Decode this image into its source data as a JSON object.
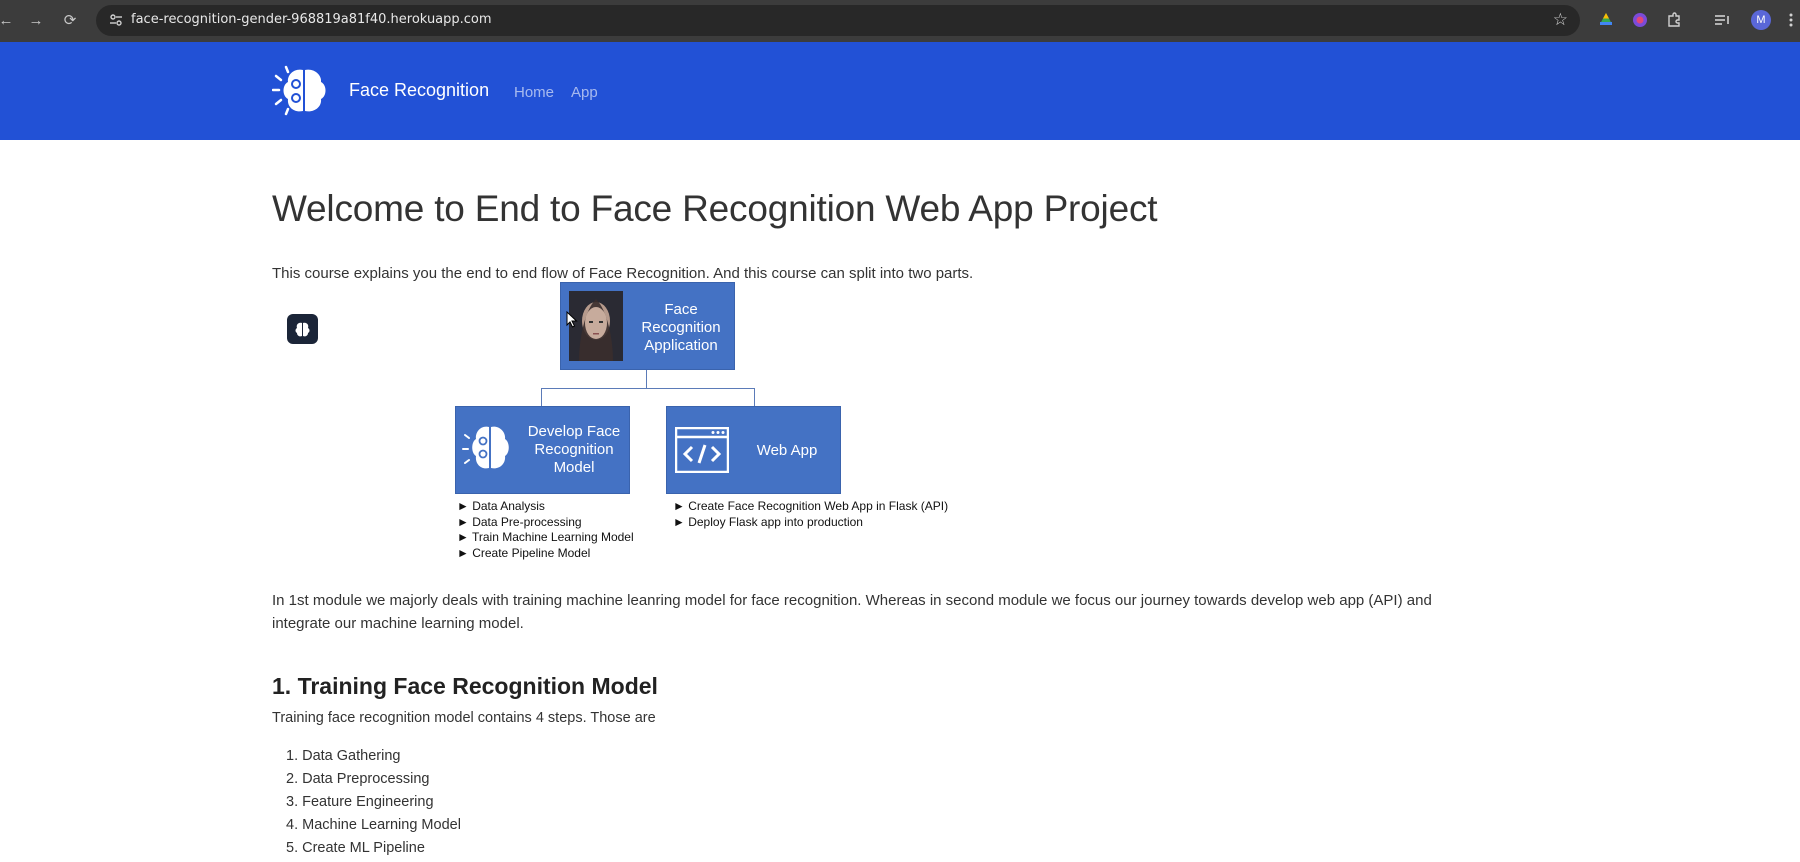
{
  "browser": {
    "url": "face-recognition-gender-968819a81f40.herokuapp.com",
    "back_icon": "←",
    "forward_icon": "→",
    "reload_icon": "⟳",
    "bookmark_icon": "☆",
    "profile_initial": "M"
  },
  "navbar": {
    "brand": "Face Recognition",
    "links": [
      "Home",
      "App"
    ],
    "background": "#2251d6"
  },
  "main": {
    "title": "Welcome to End to Face Recognition Web App Project",
    "intro": "This course explains you the end to end flow of Face Recognition. And this course can split into two parts.",
    "diagram": {
      "root_label": "Face\nRecognition\nApplication",
      "left_label": "Develop Face\nRecognition\nModel",
      "right_label": "Web App",
      "left_bullets": [
        "► Data Analysis",
        "► Data Pre-processing",
        "► Train Machine Learning Model",
        "►  Create Pipeline Model"
      ],
      "right_bullets": [
        "► Create Face Recognition Web App in Flask (API)",
        "► Deploy Flask app into production"
      ],
      "box_color": "#4472c4"
    },
    "module_text": "In 1st module we majorly deals with training machine leanring model for face recognition. Whereas in second module we focus our journey towards develop web app (API) and integrate our machine learning model.",
    "section1": {
      "heading": "1. Training Face Recognition Model",
      "intro": "Training face recognition model contains 4 steps. Those are",
      "steps": [
        "1. Data Gathering",
        "2. Data Preprocessing",
        "3. Feature Engineering",
        "4. Machine Learning Model",
        "5. Create ML Pipeline"
      ]
    }
  }
}
